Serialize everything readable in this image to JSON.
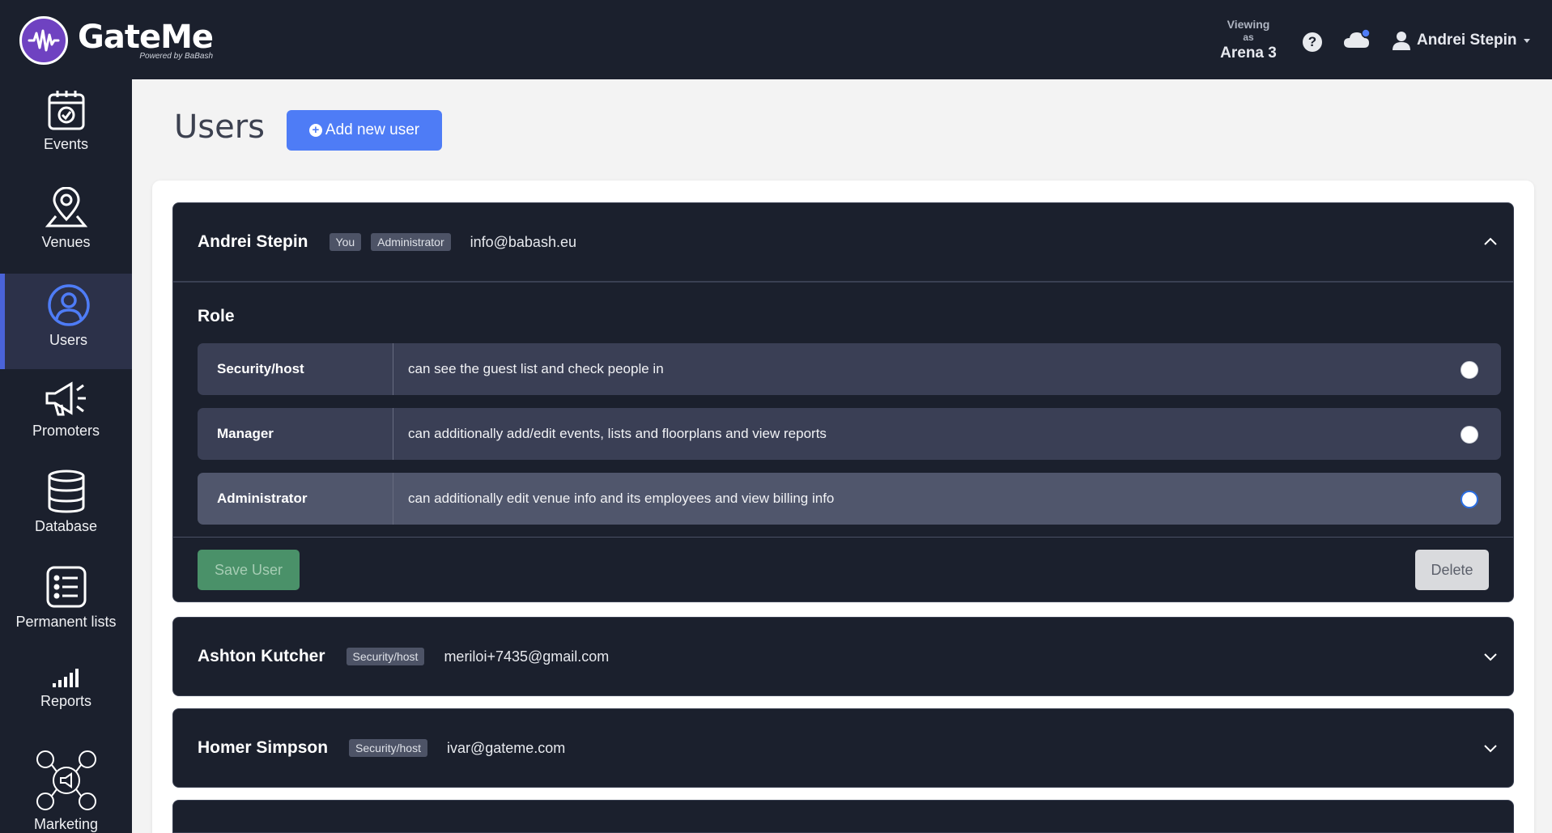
{
  "header": {
    "logo_name": "GateMe",
    "logo_powered": "Powered by BaBash",
    "viewing_label_1": "Viewing",
    "viewing_label_2": "as",
    "viewing_venue": "Arena 3",
    "help_glyph": "?",
    "user_name": "Andrei Stepin"
  },
  "sidebar": {
    "items": [
      {
        "label": "Events",
        "icon": "calendar-check-icon"
      },
      {
        "label": "Venues",
        "icon": "map-pin-icon"
      },
      {
        "label": "Users",
        "icon": "user-circle-icon",
        "active": true
      },
      {
        "label": "Promoters",
        "icon": "megaphone-icon"
      },
      {
        "label": "Database",
        "icon": "database-icon"
      },
      {
        "label": "Permanent lists",
        "icon": "list-icon"
      },
      {
        "label": "Reports",
        "icon": "bar-chart-icon"
      },
      {
        "label": "Marketing",
        "icon": "social-marketing-icon"
      }
    ]
  },
  "page": {
    "title": "Users",
    "add_button": "Add new user"
  },
  "users": [
    {
      "name": "Andrei Stepin",
      "badges": [
        "You",
        "Administrator"
      ],
      "email": "info@babash.eu",
      "expanded": true
    },
    {
      "name": "Ashton Kutcher",
      "badges": [
        "Security/host"
      ],
      "email": "meriloi+7435@gmail.com",
      "expanded": false
    },
    {
      "name": "Homer Simpson",
      "badges": [
        "Security/host"
      ],
      "email": "ivar@gateme.com",
      "expanded": false
    }
  ],
  "role_panel": {
    "title": "Role",
    "options": [
      {
        "name": "Security/host",
        "desc": "can see the guest list and check people in",
        "selected": false
      },
      {
        "name": "Manager",
        "desc": "can additionally add/edit events, lists and floorplans and view reports",
        "selected": false
      },
      {
        "name": "Administrator",
        "desc": "can additionally edit venue info and its employees and view billing info",
        "selected": true
      }
    ],
    "save_label": "Save User",
    "delete_label": "Delete"
  },
  "colors": {
    "topbar_bg": "#1b202d",
    "accent_blue": "#4e7cf6",
    "save_green": "#4a9169",
    "logo_purple": "#6f42c1"
  }
}
